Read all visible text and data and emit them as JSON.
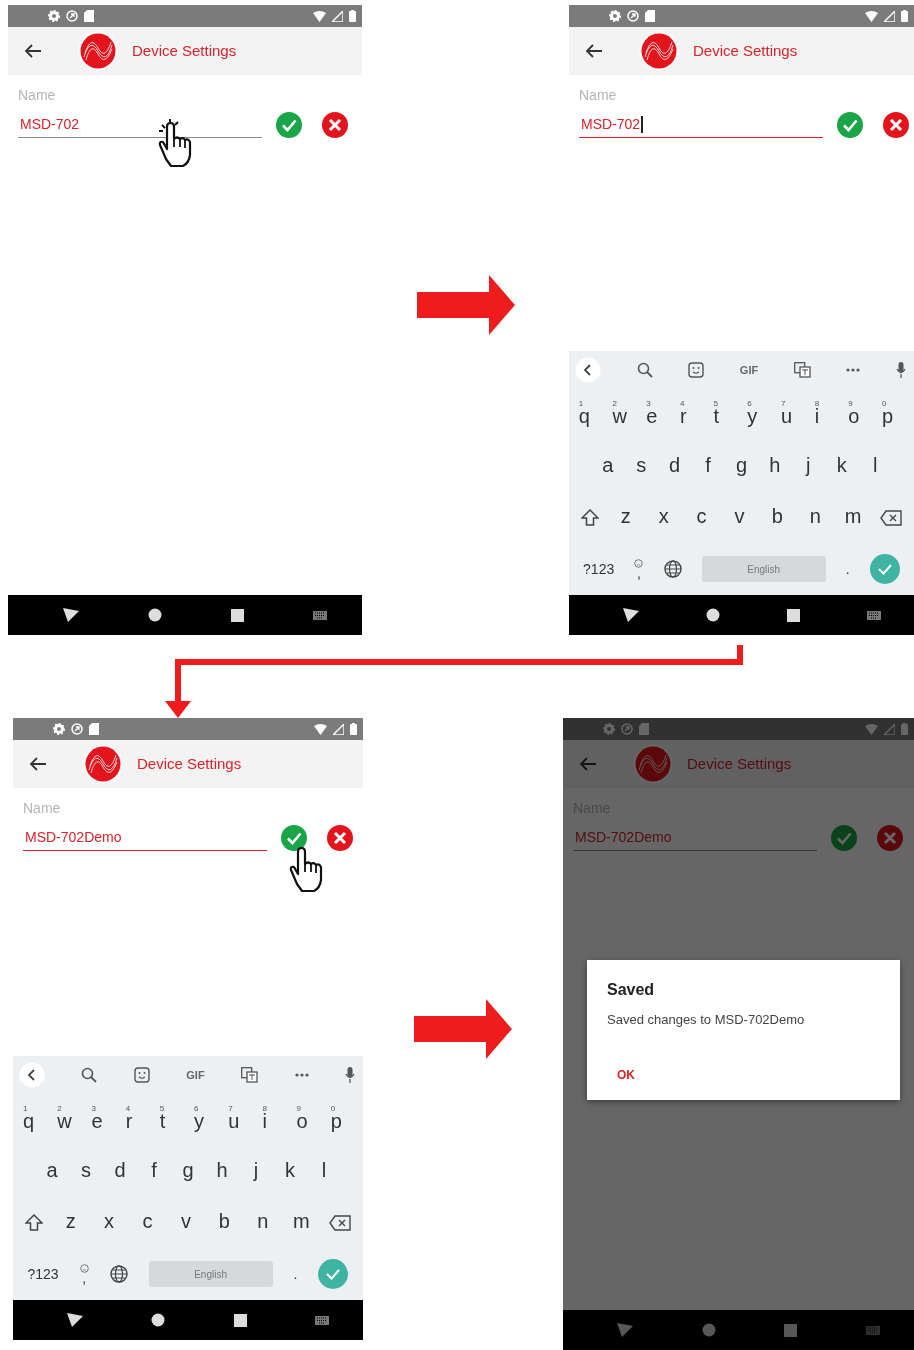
{
  "screens": [
    {
      "title": "Device Settings",
      "dimmed": false,
      "confirm_tapped": false,
      "field": {
        "label": "Name",
        "value": "MSD-702",
        "focused": false,
        "cursor": false,
        "tapped": true
      }
    },
    {
      "title": "Device Settings",
      "dimmed": false,
      "confirm_tapped": false,
      "field": {
        "label": "Name",
        "value": "MSD-702",
        "focused": true,
        "cursor": true,
        "tapped": false
      },
      "keyboard": {
        "toolbar_text": "GIF",
        "top_row": [
          {
            "key": "q",
            "hint": "1"
          },
          {
            "key": "w",
            "hint": "2"
          },
          {
            "key": "e",
            "hint": "3"
          },
          {
            "key": "r",
            "hint": "4"
          },
          {
            "key": "t",
            "hint": "5"
          },
          {
            "key": "y",
            "hint": "6"
          },
          {
            "key": "u",
            "hint": "7"
          },
          {
            "key": "i",
            "hint": "8"
          },
          {
            "key": "o",
            "hint": "9"
          },
          {
            "key": "p",
            "hint": "0"
          }
        ],
        "middle_row": [
          "a",
          "s",
          "d",
          "f",
          "g",
          "h",
          "j",
          "k",
          "l"
        ],
        "bottom_row": [
          "z",
          "x",
          "c",
          "v",
          "b",
          "n",
          "m"
        ],
        "symbols": "?123",
        "comma": ",",
        "space": "English",
        "period": "."
      }
    },
    {
      "title": "Device Settings",
      "dimmed": false,
      "confirm_tapped": true,
      "field": {
        "label": "Name",
        "value": "MSD-702Demo",
        "focused": true,
        "cursor": false,
        "tapped": false
      },
      "keyboard": {
        "toolbar_text": "GIF",
        "top_row": [
          {
            "key": "q",
            "hint": "1"
          },
          {
            "key": "w",
            "hint": "2"
          },
          {
            "key": "e",
            "hint": "3"
          },
          {
            "key": "r",
            "hint": "4"
          },
          {
            "key": "t",
            "hint": "5"
          },
          {
            "key": "y",
            "hint": "6"
          },
          {
            "key": "u",
            "hint": "7"
          },
          {
            "key": "i",
            "hint": "8"
          },
          {
            "key": "o",
            "hint": "9"
          },
          {
            "key": "p",
            "hint": "0"
          }
        ],
        "middle_row": [
          "a",
          "s",
          "d",
          "f",
          "g",
          "h",
          "j",
          "k",
          "l"
        ],
        "bottom_row": [
          "z",
          "x",
          "c",
          "v",
          "b",
          "n",
          "m"
        ],
        "symbols": "?123",
        "comma": ",",
        "space": "English",
        "period": "."
      }
    },
    {
      "title": "Device Settings",
      "dimmed": true,
      "confirm_tapped": false,
      "field": {
        "label": "Name",
        "value": "MSD-702Demo",
        "focused": false,
        "cursor": false,
        "tapped": false
      },
      "dialog": {
        "title": "Saved",
        "message": "Saved changes to MSD-702Demo",
        "button": "OK"
      }
    }
  ]
}
